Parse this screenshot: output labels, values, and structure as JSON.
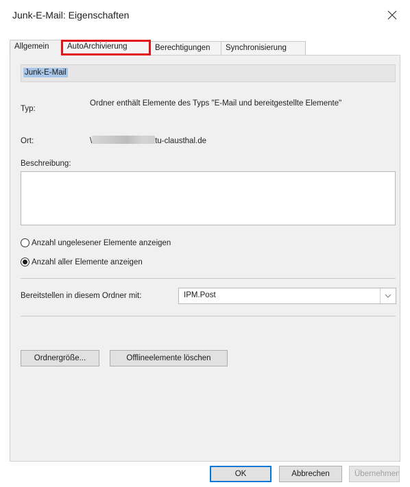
{
  "window": {
    "title": "Junk-E-Mail: Eigenschaften",
    "close_icon": "close-icon"
  },
  "tabs": [
    {
      "label": "Allgemein",
      "active": true
    },
    {
      "label": "AutoArchivierung",
      "active": false,
      "highlighted": true,
      "highlight_color": "#e2141a"
    },
    {
      "label": "Berechtigungen",
      "active": false
    },
    {
      "label": "Synchronisierung",
      "active": false
    }
  ],
  "general": {
    "folder_name": "Junk-E-Mail",
    "type_label": "Typ:",
    "type_value": "Ordner enthält Elemente des Typs \"E-Mail und bereitgestellte Elemente\"",
    "location_label": "Ort:",
    "location_prefix": "\\",
    "location_suffix": "tu-clausthal.de",
    "description_label": "Beschreibung:",
    "description_value": "",
    "radio_unread": {
      "label": "Anzahl ungelesener Elemente anzeigen",
      "checked": false
    },
    "radio_all": {
      "label": "Anzahl aller Elemente anzeigen",
      "checked": true
    },
    "post_label": "Bereitstellen in diesem Ordner mit:",
    "post_value": "IPM.Post",
    "folder_size_button": "Ordnergröße...",
    "clear_offline_button": "Offlineelemente löschen"
  },
  "footer": {
    "ok": "OK",
    "cancel": "Abbrechen",
    "apply": "Übernehmen",
    "apply_disabled": true
  }
}
